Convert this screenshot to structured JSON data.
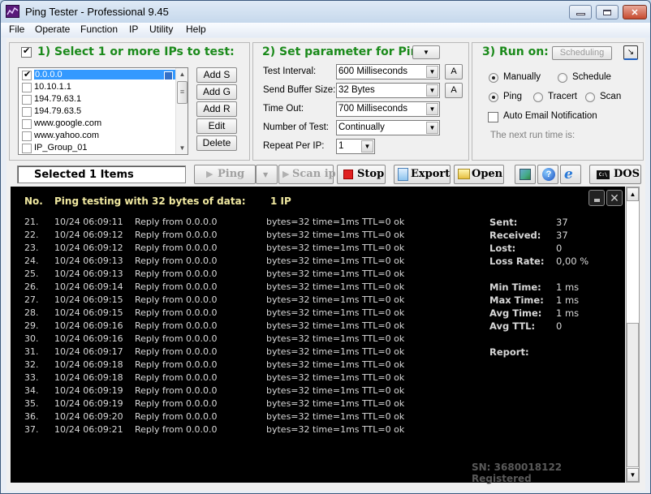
{
  "window": {
    "title": "Ping Tester - Professional  9.45"
  },
  "menu": [
    "File",
    "Operate",
    "Function",
    "IP",
    "Utility",
    "Help"
  ],
  "section1": {
    "title": "1) Select 1 or more IPs to test:",
    "select_all_checked": true,
    "ip_list": [
      {
        "label": "0.0.0.0",
        "checked": true,
        "selected": true
      },
      {
        "label": "10.10.1.1",
        "checked": false,
        "selected": false
      },
      {
        "label": "194.79.63.1",
        "checked": false,
        "selected": false
      },
      {
        "label": "194.79.63.5",
        "checked": false,
        "selected": false
      },
      {
        "label": "www.google.com",
        "checked": false,
        "selected": false
      },
      {
        "label": "www.yahoo.com",
        "checked": false,
        "selected": false
      },
      {
        "label": "IP_Group_01",
        "checked": false,
        "selected": false
      }
    ],
    "buttons": [
      "Add S",
      "Add G",
      "Add R",
      "Edit",
      "Delete"
    ]
  },
  "section2": {
    "title": "2) Set parameter for Ping:",
    "params": [
      {
        "label": "Test Interval:",
        "value": "600  Milliseconds",
        "has_a_button": true
      },
      {
        "label": "Send Buffer Size:",
        "value": "32  Bytes",
        "has_a_button": true
      },
      {
        "label": "Time Out:",
        "value": "700  Milliseconds",
        "has_a_button": false
      },
      {
        "label": "Number of Test:",
        "value": "Continually",
        "has_a_button": false
      },
      {
        "label": "Repeat Per IP:",
        "value": "1",
        "has_a_button": false
      }
    ],
    "a_button_label": "A"
  },
  "section3": {
    "title": "3) Run on:",
    "scheduling_label": "Scheduling",
    "run_mode": [
      {
        "label": "Manually",
        "selected": true
      },
      {
        "label": "Schedule",
        "selected": false
      }
    ],
    "test_type": [
      {
        "label": "Ping",
        "selected": true
      },
      {
        "label": "Tracert",
        "selected": false
      },
      {
        "label": "Scan",
        "selected": false
      }
    ],
    "auto_email_label": "Auto Email Notification",
    "auto_email_checked": false,
    "next_run_label": "The next run time is:"
  },
  "toolbar": {
    "status": "Selected 1 Items",
    "ping_label": "Ping",
    "scan_label": "Scan ip",
    "stop_label": "Stop",
    "export_label": "Export",
    "open_label": "Open",
    "dos_label": "DOS"
  },
  "console": {
    "header": {
      "no": "No.",
      "title": "Ping testing with 32 bytes of data:",
      "count": "1  IP"
    },
    "rows": [
      {
        "no": "21.",
        "time": "10/24 06:09:11",
        "msg": "Reply from 0.0.0.0",
        "detail": "bytes=32  time=1ms  TTL=0  ok"
      },
      {
        "no": "22.",
        "time": "10/24 06:09:12",
        "msg": "Reply from 0.0.0.0",
        "detail": "bytes=32  time=1ms  TTL=0  ok"
      },
      {
        "no": "23.",
        "time": "10/24 06:09:12",
        "msg": "Reply from 0.0.0.0",
        "detail": "bytes=32  time=1ms  TTL=0  ok"
      },
      {
        "no": "24.",
        "time": "10/24 06:09:13",
        "msg": "Reply from 0.0.0.0",
        "detail": "bytes=32  time=1ms  TTL=0  ok"
      },
      {
        "no": "25.",
        "time": "10/24 06:09:13",
        "msg": "Reply from 0.0.0.0",
        "detail": "bytes=32  time=1ms  TTL=0  ok"
      },
      {
        "no": "26.",
        "time": "10/24 06:09:14",
        "msg": "Reply from 0.0.0.0",
        "detail": "bytes=32  time=1ms  TTL=0  ok"
      },
      {
        "no": "27.",
        "time": "10/24 06:09:15",
        "msg": "Reply from 0.0.0.0",
        "detail": "bytes=32  time=1ms  TTL=0  ok"
      },
      {
        "no": "28.",
        "time": "10/24 06:09:15",
        "msg": "Reply from 0.0.0.0",
        "detail": "bytes=32  time=1ms  TTL=0  ok"
      },
      {
        "no": "29.",
        "time": "10/24 06:09:16",
        "msg": "Reply from 0.0.0.0",
        "detail": "bytes=32  time=1ms  TTL=0  ok"
      },
      {
        "no": "30.",
        "time": "10/24 06:09:16",
        "msg": "Reply from 0.0.0.0",
        "detail": "bytes=32  time=1ms  TTL=0  ok"
      },
      {
        "no": "31.",
        "time": "10/24 06:09:17",
        "msg": "Reply from 0.0.0.0",
        "detail": "bytes=32  time=1ms  TTL=0  ok"
      },
      {
        "no": "32.",
        "time": "10/24 06:09:18",
        "msg": "Reply from 0.0.0.0",
        "detail": "bytes=32  time=1ms  TTL=0  ok"
      },
      {
        "no": "33.",
        "time": "10/24 06:09:18",
        "msg": "Reply from 0.0.0.0",
        "detail": "bytes=32  time=1ms  TTL=0  ok"
      },
      {
        "no": "34.",
        "time": "10/24 06:09:19",
        "msg": "Reply from 0.0.0.0",
        "detail": "bytes=32  time=1ms  TTL=0  ok"
      },
      {
        "no": "35.",
        "time": "10/24 06:09:19",
        "msg": "Reply from 0.0.0.0",
        "detail": "bytes=32  time=1ms  TTL=0  ok"
      },
      {
        "no": "36.",
        "time": "10/24 06:09:20",
        "msg": "Reply from 0.0.0.0",
        "detail": "bytes=32  time=1ms  TTL=0  ok"
      },
      {
        "no": "37.",
        "time": "10/24 06:09:21",
        "msg": "Reply from 0.0.0.0",
        "detail": "bytes=32  time=1ms  TTL=0  ok"
      }
    ],
    "stats": [
      {
        "key": "Sent:",
        "value": "37"
      },
      {
        "key": "Received:",
        "value": "37"
      },
      {
        "key": "Lost:",
        "value": "0"
      },
      {
        "key": "Loss Rate:",
        "value": "0,00 %"
      },
      {
        "key": "Min Time:",
        "value": "1 ms"
      },
      {
        "key": "Max Time:",
        "value": "1 ms"
      },
      {
        "key": "Avg Time:",
        "value": "1 ms"
      },
      {
        "key": "Avg TTL:",
        "value": "0"
      },
      {
        "key": "Report:",
        "value": ""
      }
    ],
    "footer": "SN: 3680018122  Registered"
  },
  "colors": {
    "section_title": "#1a8a1a",
    "console_bg": "#000000",
    "console_text": "#d8d8d8",
    "console_header": "#f0e8a0",
    "selection": "#3399ff",
    "stop_icon": "#e02020"
  }
}
